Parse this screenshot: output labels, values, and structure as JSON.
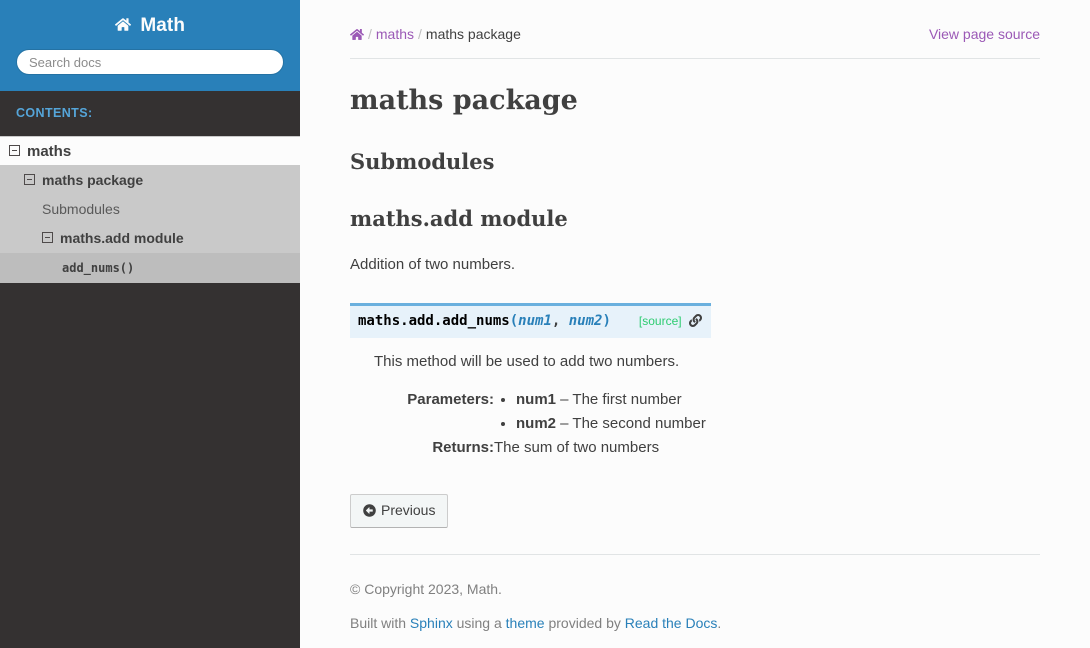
{
  "sidebar": {
    "brand": "Math",
    "brand_icon": "home-icon",
    "search": {
      "placeholder": "Search docs",
      "value": ""
    },
    "caption": "CONTENTS:",
    "nav": {
      "l1_label": "maths",
      "l2_label": "maths package",
      "l3_submodules": "Submodules",
      "l3_module": "maths.add module",
      "l4_current": "add_nums()"
    }
  },
  "breadcrumb": {
    "home_icon": "home-icon",
    "separator": "/",
    "items": [
      {
        "label": "maths",
        "is_link": true
      },
      {
        "label": "maths package",
        "is_link": false
      }
    ],
    "view_source": "View page source"
  },
  "content": {
    "title": "maths package",
    "submodules_heading": "Submodules",
    "module_heading": "maths.add module",
    "module_intro": "Addition of two numbers.",
    "function": {
      "prename": "maths.add.",
      "name": "add_nums",
      "open_paren": "(",
      "params": [
        "num1",
        "num2"
      ],
      "param_separator": ", ",
      "close_paren": ")",
      "source_label": "[source]",
      "anchor_icon": "link-icon",
      "description": "This method will be used to add two numbers.",
      "fields": [
        {
          "name": "Parameters:",
          "type": "list",
          "items": [
            {
              "term": "num1",
              "dash": " – ",
              "text": "The first number"
            },
            {
              "term": "num2",
              "dash": " – ",
              "text": "The second number"
            }
          ]
        },
        {
          "name": "Returns:",
          "type": "text",
          "text": "The sum of two numbers"
        }
      ]
    }
  },
  "footer_nav": {
    "previous_label": "Previous",
    "previous_icon": "circle-arrow-left-icon"
  },
  "footer": {
    "copyright": "© Copyright 2023, Math.",
    "built_with_prefix": "Built with ",
    "sphinx_link": "Sphinx",
    "using_a": " using a ",
    "theme_link": "theme",
    "provided_by": " provided by ",
    "rtd_link": "Read the Docs",
    "period": "."
  },
  "colors": {
    "sidebar_search_bg": "#2980b9",
    "sidebar_bg": "#343131",
    "caption_text": "#55a5d9",
    "nav_l2_bg": "#c9c9c9",
    "nav_current_bg": "#bdbdbd",
    "breadcrumb_link": "#9B59B6",
    "signature_bg": "#e7f2fa",
    "signature_border": "#6ab0de",
    "source_link": "#2ecc71",
    "footer_link": "#2980b9",
    "body_text": "#404040",
    "content_bg": "#fcfcfc"
  }
}
